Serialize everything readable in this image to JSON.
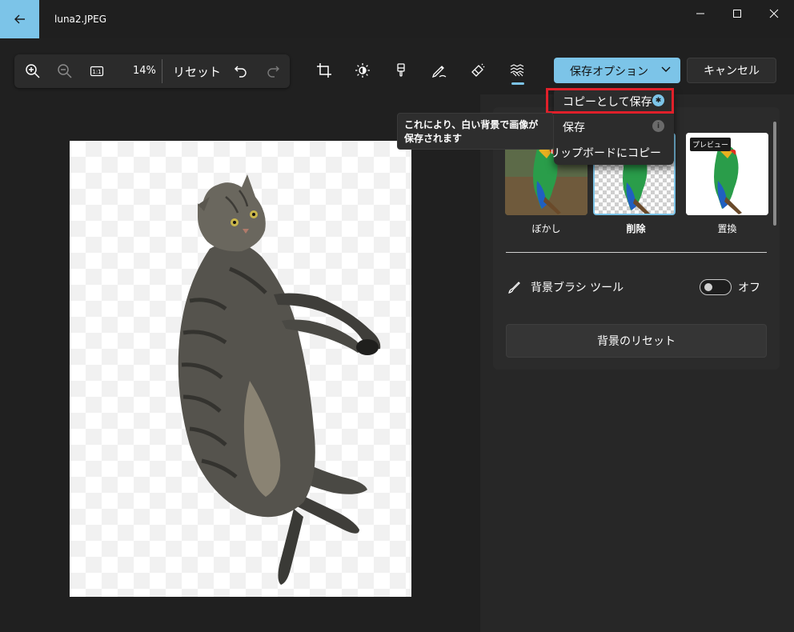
{
  "window": {
    "title": "luna2.JPEG",
    "back_icon": "back-arrow-icon",
    "minimize_icon": "minimize-icon",
    "maximize_icon": "maximize-icon",
    "close_icon": "close-icon"
  },
  "toolbar": {
    "zoom_in_icon": "zoom-in-icon",
    "zoom_out_icon": "zoom-out-icon",
    "actual_size_icon": "actual-size-icon",
    "zoom_percent": "14%",
    "reset_label": "リセット",
    "undo_icon": "undo-icon",
    "redo_icon": "redo-icon",
    "tools": [
      "crop-icon",
      "brightness-icon",
      "filter-icon",
      "markup-icon",
      "erase-icon",
      "background-icon"
    ],
    "active_tool": "background-icon",
    "save_options_label": "保存オプション",
    "cancel_label": "キャンセル"
  },
  "dropdown": {
    "items": [
      {
        "label": "コピーとして保存",
        "icon": "info-icon-accent"
      },
      {
        "label": "保存",
        "icon": "info-icon"
      },
      {
        "label": "リップボードにコピー"
      }
    ]
  },
  "tooltip": {
    "line1": "これにより、白い背景で画像が",
    "line2": "保存されます"
  },
  "background_panel": {
    "options": [
      {
        "label": "ぼかし"
      },
      {
        "label": "削除",
        "selected": true
      },
      {
        "label": "置換",
        "badge": "プレビュー"
      }
    ],
    "brush_tool_label": "背景ブラシ ツール",
    "brush_tool_state": "オフ",
    "reset_background_label": "背景のリセット"
  },
  "colors": {
    "accent": "#7cc4e8",
    "highlight_border": "#e0202a",
    "background": "#202020"
  }
}
